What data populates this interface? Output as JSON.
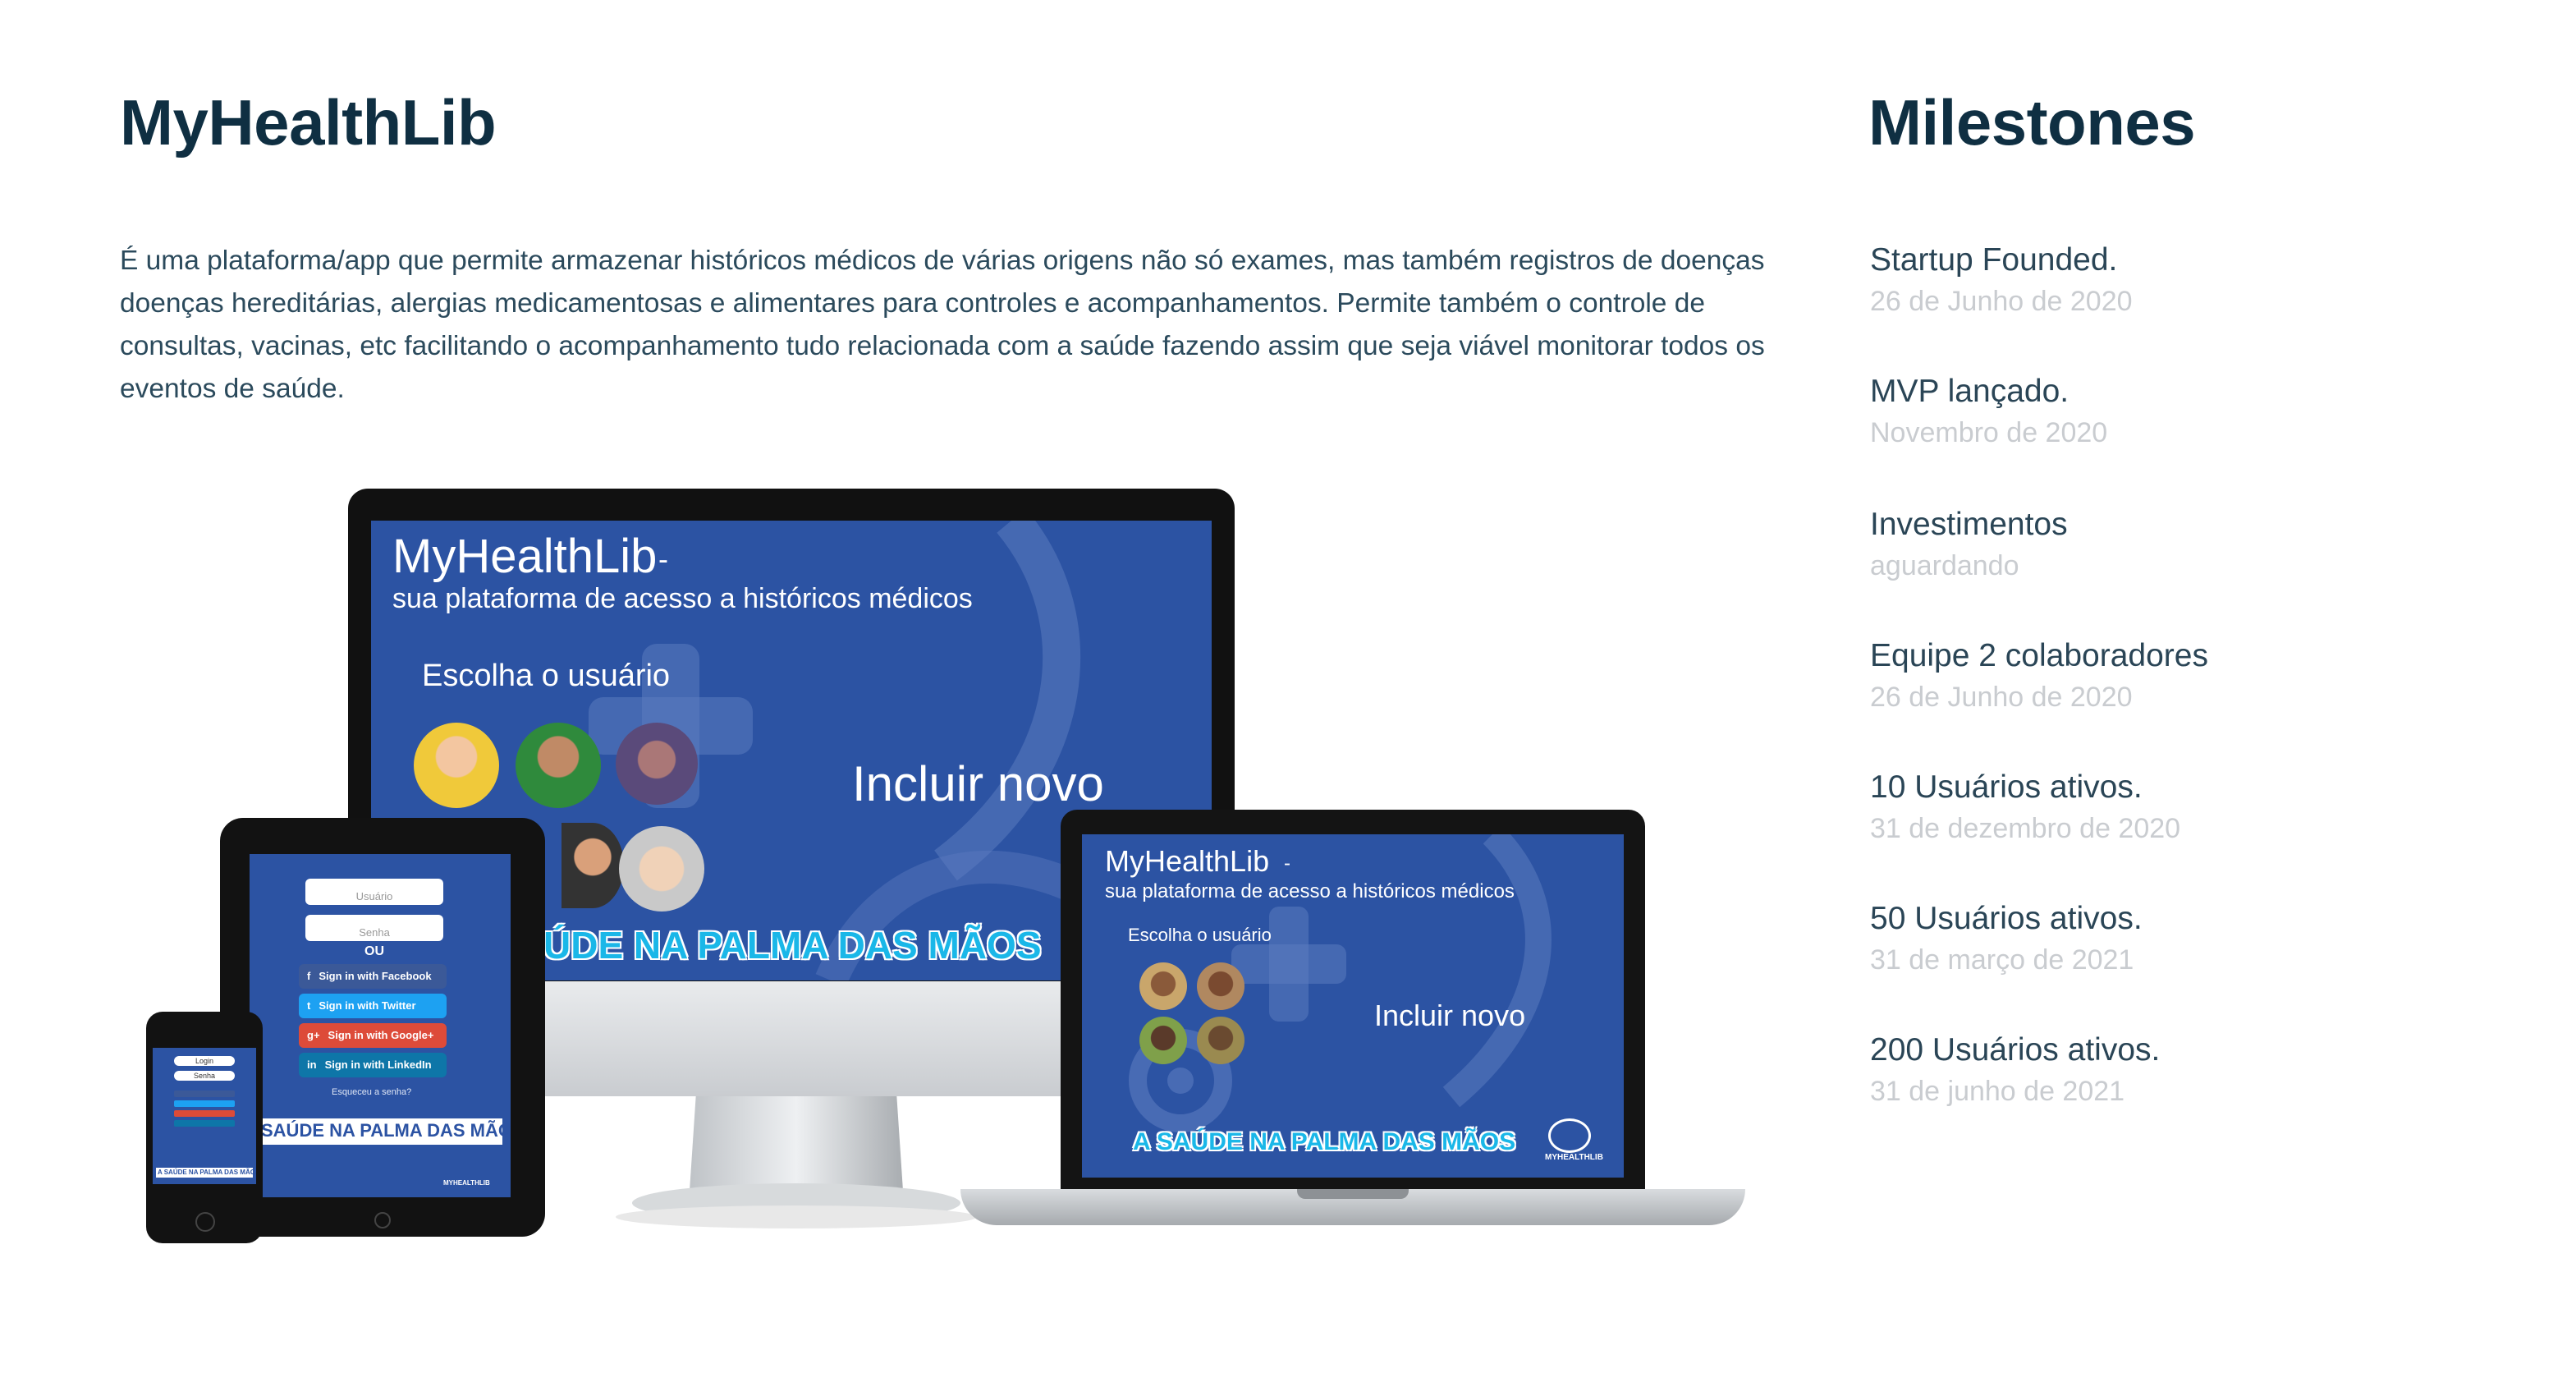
{
  "app": {
    "title": "MyHealthLib",
    "description": "É uma plataforma/app que permite armazenar históricos médicos de várias origens não só exames, mas também registros de doenças doenças hereditárias,  alergias medicamentosas e alimentares para  controles e acompanhamentos.  Permite também o controle de consultas, vacinas, etc  facilitando o acompanhamento tudo relacionada com a saúde fazendo assim que seja viável monitorar todos os eventos de saúde."
  },
  "milestones": {
    "title": "Milestones",
    "items": [
      {
        "title": "Startup Founded.",
        "date": "26 de Junho de 2020"
      },
      {
        "title": "MVP lançado.",
        "date": "Novembro de 2020"
      },
      {
        "title": "Investimentos",
        "date": "aguardando"
      },
      {
        "title": "Equipe 2 colaboradores",
        "date": "26 de Junho de 2020"
      },
      {
        "title": "10 Usuários ativos.",
        "date": "31 de dezembro de 2020"
      },
      {
        "title": "50 Usuários ativos.",
        "date": "31 de março de 2021"
      },
      {
        "title": "200 Usuários ativos.",
        "date": "31 de junho de 2021"
      }
    ]
  },
  "mockup": {
    "monitor": {
      "heading": "MyHealthLib",
      "dash": "-",
      "subheading": "sua plataforma de acesso a históricos médicos",
      "choose_user": "Escolha o usuário",
      "add_new": "Incluir novo",
      "slogan": "ÚDE NA PALMA DAS MÃOS"
    },
    "laptop": {
      "heading": "MyHealthLib",
      "dash": "-",
      "subheading": "sua plataforma de acesso a históricos médicos",
      "choose_user": "Escolha o usuário",
      "add_new": "Incluir novo",
      "slogan": "A SAÚDE NA PALMA DAS MÃOS",
      "brand": "MYHEALTHLIB"
    },
    "tablet": {
      "user_placeholder": "Usuário",
      "password_placeholder": "Senha",
      "or": "OU",
      "facebook": "Sign in with Facebook",
      "twitter": "Sign in with Twitter",
      "google": "Sign in with Google+",
      "linkedin": "Sign in with LinkedIn",
      "forgot": "Esqueceu a senha?",
      "slogan": "SAÚDE NA PALMA DAS MÃOS",
      "brand": "MYHEALTHLIB"
    },
    "phone": {
      "login": "Login",
      "password": "Senha",
      "slogan": "A SAÚDE NA PALMA DAS MÃOS"
    },
    "colors": {
      "screen": "#2c53a3",
      "facebook": "#3b5998",
      "twitter": "#1da1f2",
      "google": "#dd4b39",
      "linkedin": "#0e76a8",
      "slogan": "#1ab7e8"
    }
  }
}
